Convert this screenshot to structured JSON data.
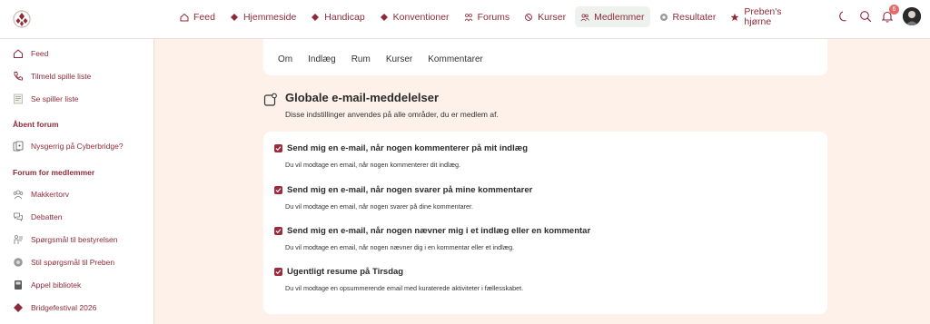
{
  "nav": {
    "items": [
      {
        "label": "Feed",
        "icon": "home-icon"
      },
      {
        "label": "Hjemmeside",
        "icon": "diamond-icon"
      },
      {
        "label": "Handicap",
        "icon": "diamond-icon"
      },
      {
        "label": "Konventioner",
        "icon": "diamond-icon"
      },
      {
        "label": "Forums",
        "icon": "forums-icon"
      },
      {
        "label": "Kurser",
        "icon": "courses-icon"
      },
      {
        "label": "Medlemmer",
        "icon": "members-icon"
      },
      {
        "label": "Resultater",
        "icon": "results-icon"
      },
      {
        "label": "Preben's hjørne",
        "icon": "star-icon"
      }
    ],
    "notification_count": "6"
  },
  "sidebar": {
    "items": [
      {
        "label": "Feed",
        "icon": "home-icon"
      },
      {
        "label": "Tilmeld spille liste",
        "icon": "phone-icon"
      },
      {
        "label": "Se spiller liste",
        "icon": "list-icon"
      }
    ],
    "open_forum_heading": "Åbent forum",
    "open_forum_items": [
      {
        "label": "Nysgerrig på Cyberbridge?",
        "icon": "cards-icon"
      }
    ],
    "member_forum_heading": "Forum for medlemmer",
    "member_forum_items": [
      {
        "label": "Makkertorv",
        "icon": "group-icon"
      },
      {
        "label": "Debatten",
        "icon": "chat-icon"
      },
      {
        "label": "Spørgsmål til bestyrelsen",
        "icon": "board-icon"
      },
      {
        "label": "Stil spørgsmål til Preben",
        "icon": "question-icon"
      },
      {
        "label": "Appel bibliotek",
        "icon": "book-icon"
      },
      {
        "label": "Bridgefestival 2026",
        "icon": "diamond-icon"
      }
    ]
  },
  "tabs": [
    "Om",
    "Indlæg",
    "Rum",
    "Kurser",
    "Kommentarer"
  ],
  "section": {
    "title": "Globale e-mail-meddelelser",
    "subtitle": "Disse indstillinger anvendes på alle områder, du er medlem af."
  },
  "options": [
    {
      "label": "Send mig en e-mail, når nogen kommenterer på mit indlæg",
      "description": "Du vil modtage en email, når nogen kommenterer dit indlæg.",
      "checked": true
    },
    {
      "label": "Send mig en e-mail, når nogen svarer på mine kommentarer",
      "description": "Du vil modtage en email, når nogen svarer på dine kommentarer.",
      "checked": true
    },
    {
      "label": "Send mig en e-mail, når nogen nævner mig i et indlæg eller en kommentar",
      "description": "Du vil modtage en email, når nogen nævner dig i en kommentar eller et indlæg.",
      "checked": true
    },
    {
      "label": "Ugentligt resume på Tirsdag",
      "description": "Du vil modtage en opsummerende email med kuraterede aktiviteter i fællesskabet.",
      "checked": true
    }
  ],
  "colors": {
    "accent": "#8e2b3a",
    "checkbox": "#9b2b3d",
    "page_bg": "#fdf1ea",
    "active_tab_bg": "#eef2ee",
    "badge": "#e56a6a"
  }
}
